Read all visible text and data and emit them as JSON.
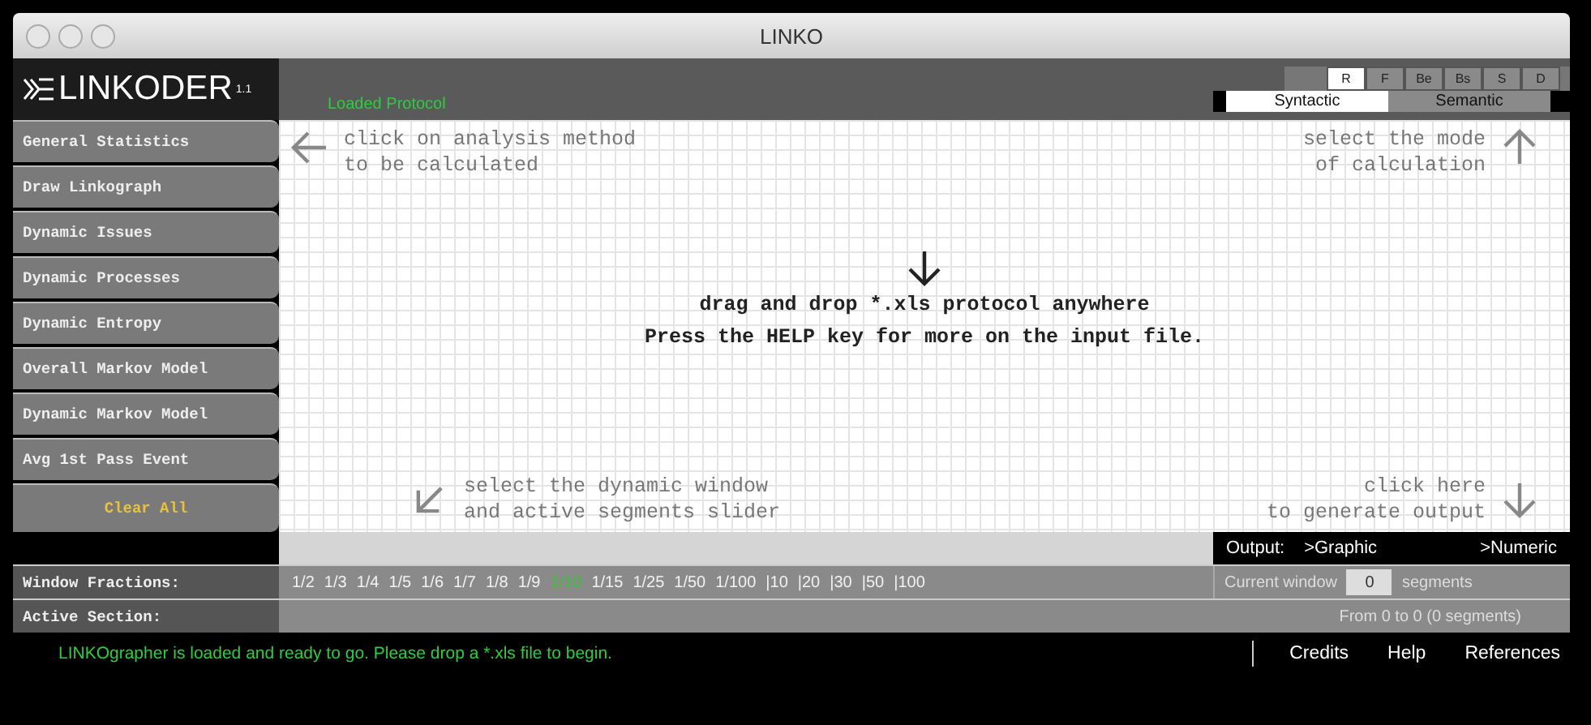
{
  "window": {
    "title": "LINKO"
  },
  "header": {
    "logo": "LINKODER",
    "logo_version": "1.1",
    "protocol_status": "Loaded Protocol"
  },
  "modes": [
    {
      "label": "R",
      "selected": true
    },
    {
      "label": "F",
      "selected": false
    },
    {
      "label": "Be",
      "selected": false
    },
    {
      "label": "Bs",
      "selected": false
    },
    {
      "label": "S",
      "selected": false
    },
    {
      "label": "D",
      "selected": false
    }
  ],
  "calc_tabs": [
    {
      "label": "Syntactic",
      "selected": true
    },
    {
      "label": "Semantic",
      "selected": false
    }
  ],
  "sidebar": {
    "items": [
      "General Statistics",
      "Draw Linkograph",
      "Dynamic Issues",
      "Dynamic Processes",
      "Dynamic Entropy",
      "Overall Markov Model",
      "Dynamic Markov Model",
      "Avg 1st Pass Event"
    ],
    "clear": "Clear All"
  },
  "canvas": {
    "hint_top_left": [
      "click on analysis method",
      "to be calculated"
    ],
    "hint_top_right": [
      "select the mode",
      "of calculation"
    ],
    "center": [
      "drag and drop *.xls protocol anywhere",
      "Press the HELP key for more on the input file."
    ],
    "hint_bottom_left": [
      "select the dynamic window",
      "and active segments slider"
    ],
    "hint_bottom_right": [
      "click here",
      "to generate output"
    ]
  },
  "output": {
    "label": "Output:",
    "options": [
      ">Graphic",
      ">Numeric"
    ]
  },
  "window_fractions": {
    "label": "Window Fractions:",
    "items": [
      {
        "label": "1/2",
        "selected": false
      },
      {
        "label": "1/3",
        "selected": false
      },
      {
        "label": "1/4",
        "selected": false
      },
      {
        "label": "1/5",
        "selected": false
      },
      {
        "label": "1/6",
        "selected": false
      },
      {
        "label": "1/7",
        "selected": false
      },
      {
        "label": "1/8",
        "selected": false
      },
      {
        "label": "1/9",
        "selected": false
      },
      {
        "label": "1/10",
        "selected": true
      },
      {
        "label": "1/15",
        "selected": false
      },
      {
        "label": "1/25",
        "selected": false
      },
      {
        "label": "1/50",
        "selected": false
      },
      {
        "label": "1/100",
        "selected": false
      },
      {
        "label": "|10",
        "selected": false
      },
      {
        "label": "|20",
        "selected": false
      },
      {
        "label": "|30",
        "selected": false
      },
      {
        "label": "|50",
        "selected": false
      },
      {
        "label": "|100",
        "selected": false
      }
    ],
    "current_label": "Current window",
    "current_value": "0",
    "unit": "segments"
  },
  "active_section": {
    "label": "Active Section:",
    "range": "From 0 to 0 (0 segments)"
  },
  "status": "LINKOgrapher is loaded and ready to go. Please drop a *.xls file to begin.",
  "links": [
    "Credits",
    "Help",
    "References"
  ]
}
